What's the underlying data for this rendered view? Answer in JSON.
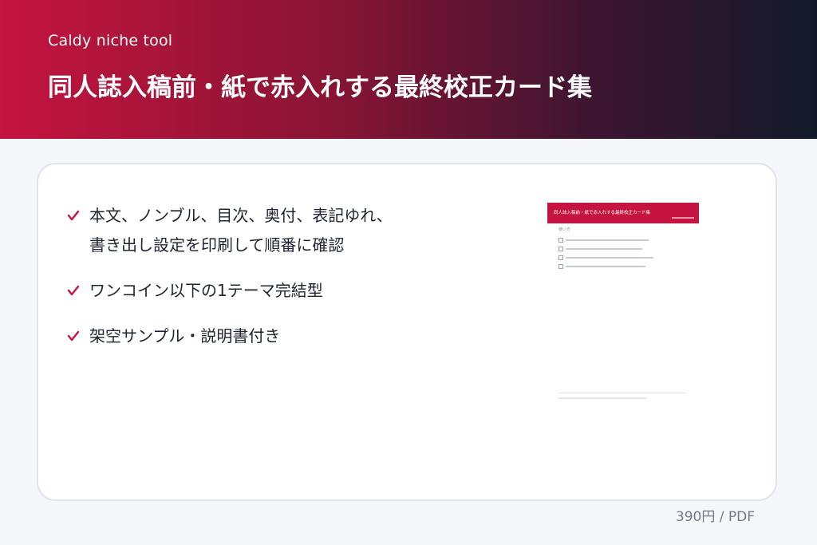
{
  "header": {
    "brand": "Caldy niche tool",
    "title": "同人誌入稿前・紙で赤入れする最終校正カード集",
    "gradient": [
      "#c4143f",
      "#121a2a"
    ]
  },
  "features": [
    {
      "line1": "本文、ノンブル、目次、奥付、表記ゆれ、",
      "line2": "書き出し設定を印刷して順番に確認"
    },
    {
      "line1": "ワンコイン以下の1テーマ完結型",
      "line2": ""
    },
    {
      "line1": "架空サンプル・説明書付き",
      "line2": ""
    }
  ],
  "check_icon": "checkmark-icon",
  "accent_color": "#c4143f",
  "preview": {
    "title": "同人誌入稿前・紙で赤入れする最終校正カード集",
    "heading": "使い方"
  },
  "price": "390円 / PDF"
}
